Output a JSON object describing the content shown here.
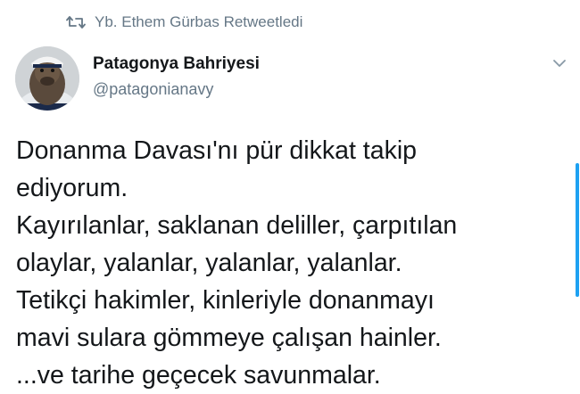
{
  "retweet": {
    "icon": "retweet-icon",
    "label": "Yb. Ethem Gürbas Retweetledi"
  },
  "author": {
    "avatar": "seal-avatar",
    "display_name": "Patagonya Bahriyesi",
    "handle": "@patagonianavy"
  },
  "menu": {
    "icon": "chevron-down-icon"
  },
  "tweet": {
    "lines": [
      "Donanma Davası'nı pür dikkat takip",
      "ediyorum.",
      "Kayırılanlar, saklanan deliller, çarpıtılan",
      "olaylar, yalanlar, yalanlar, yalanlar.",
      "Tetikçi hakimler, kinleriyle donanmayı",
      "mavi sulara gömmeye çalışan hainler.",
      "...ve tarihe geçecek savunmalar."
    ]
  },
  "colors": {
    "secondary_text": "#657786",
    "primary_text": "#14171a",
    "accent": "#1da1f2"
  }
}
